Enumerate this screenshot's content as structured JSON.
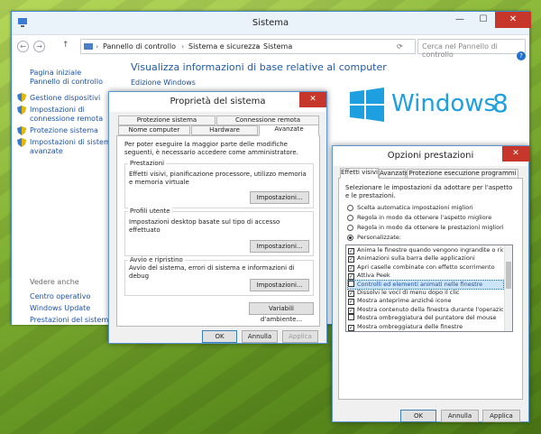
{
  "window": {
    "title": "Sistema",
    "minimize": "—",
    "maximize": "☐",
    "close": "✕"
  },
  "address": {
    "path": [
      "Pannello di controllo",
      "Sistema e sicurezza",
      "Sistema"
    ],
    "search_placeholder": "Cerca nel Pannello di controllo"
  },
  "sidebar": {
    "home": "Pagina iniziale Pannello di controllo",
    "items": [
      "Gestione dispositivi",
      "Impostazioni di connessione remota",
      "Protezione sistema",
      "Impostazioni di sistema avanzate"
    ],
    "see_also": "Vedere anche",
    "links": [
      "Centro operativo",
      "Windows Update",
      "Prestazioni del sistema"
    ]
  },
  "main": {
    "heading": "Visualizza informazioni di base relative al computer",
    "edition": "Edizione Windows",
    "logo_text": "Windows",
    "logo_num": "8"
  },
  "props": {
    "title": "Proprietà del sistema",
    "tabs_row1": [
      "Protezione sistema",
      "Connessione remota"
    ],
    "tabs_row2": [
      "Nome computer",
      "Hardware",
      "Avanzate"
    ],
    "intro": "Per poter eseguire la maggior parte delle modifiche seguenti, è necessario accedere come amministratore.",
    "groups": [
      {
        "title": "Prestazioni",
        "desc": "Effetti visivi, pianificazione processore, utilizzo memoria e memoria virtuale",
        "button": "Impostazioni..."
      },
      {
        "title": "Profili utente",
        "desc": "Impostazioni desktop basate sul tipo di accesso effettuato",
        "button": "Impostazioni..."
      },
      {
        "title": "Avvio e ripristino",
        "desc": "Avvio del sistema, errori di sistema e informazioni di debug",
        "button": "Impostazioni..."
      }
    ],
    "env_button": "Variabili d'ambiente...",
    "ok": "OK",
    "cancel": "Annulla",
    "apply": "Applica"
  },
  "perf": {
    "title": "Opzioni prestazioni",
    "tabs": [
      "Effetti visivi",
      "Avanzate",
      "Protezione esecuzione programmi"
    ],
    "intro": "Selezionare le impostazioni da adottare per l'aspetto e le prestazioni.",
    "radios": [
      {
        "label": "Scelta automatica impostazioni migliori",
        "checked": false
      },
      {
        "label": "Regola in modo da ottenere l'aspetto migliore",
        "checked": false
      },
      {
        "label": "Regola in modo da ottenere le prestazioni migliori",
        "checked": false
      },
      {
        "label": "Personalizzate:",
        "checked": true
      }
    ],
    "items": [
      {
        "label": "Anima le finestre quando vengono ingrandite o ridotte ad i",
        "checked": true
      },
      {
        "label": "Animazioni sulla barra delle applicazioni",
        "checked": true
      },
      {
        "label": "Apri caselle combinate con effetto scorrimento",
        "checked": true
      },
      {
        "label": "Attiva Peek",
        "checked": true
      },
      {
        "label": "Controlli ed elementi animati nelle finestre",
        "checked": false
      },
      {
        "label": "Dissolvi le voci di menu dopo il clic",
        "checked": true
      },
      {
        "label": "Mostra anteprime anziché icone",
        "checked": true
      },
      {
        "label": "Mostra contenuto della finestra durante l'operazione di tra",
        "checked": true
      },
      {
        "label": "Mostra ombreggiatura del puntatore del mouse",
        "checked": false
      },
      {
        "label": "Mostra ombreggiatura delle finestre",
        "checked": true
      }
    ],
    "highlighted_index": 4,
    "ok": "OK",
    "cancel": "Annulla",
    "apply": "Applica"
  },
  "colors": {
    "accent": "#1e5aa8",
    "close": "#c7362a",
    "logo": "#1d9fe0"
  }
}
